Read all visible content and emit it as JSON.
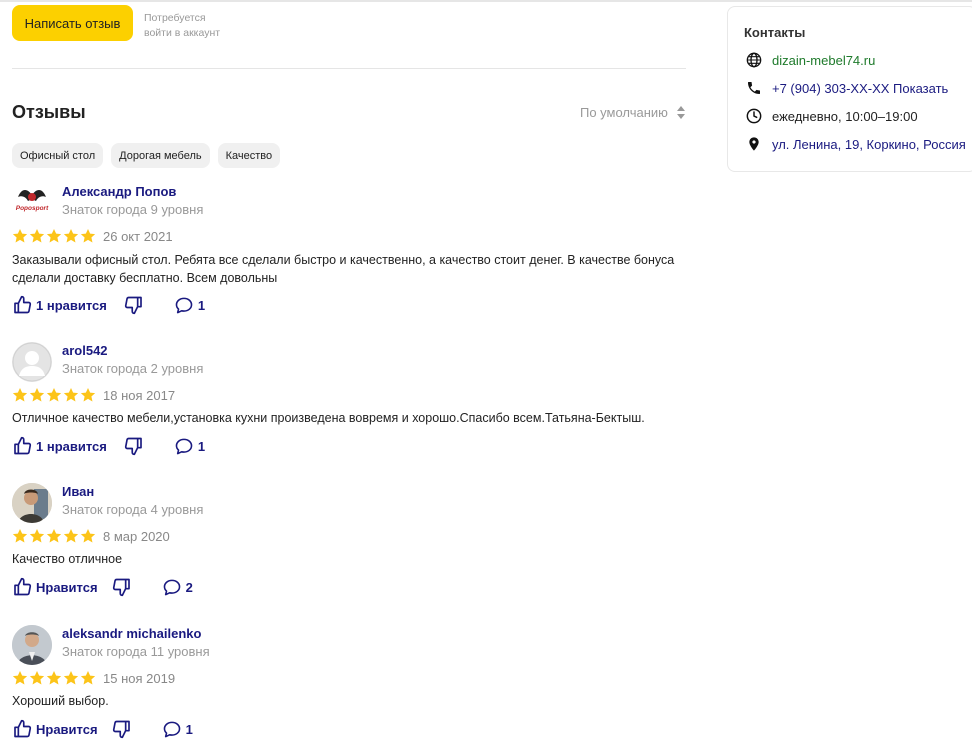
{
  "write_review": {
    "button_label": "Написать отзыв",
    "hint_line1": "Потребуется",
    "hint_line2": "войти в аккаунт"
  },
  "reviews_section": {
    "title": "Отзывы",
    "sort_label": "По умолчанию",
    "tags": [
      "Офисный стол",
      "Дорогая мебель",
      "Качество"
    ]
  },
  "reviews": [
    {
      "author": "Александр Попов",
      "level": "Знаток города 9 уровня",
      "rating": 5,
      "date": "26 окт 2021",
      "text": "Заказывали офисный стол. Ребята все сделали быстро и качественно, а качество стоит денег. В качестве бонуса сделали доставку бесплатно. Всем довольны",
      "likes_label": "1 нравится",
      "comments": "1"
    },
    {
      "author": "arol542",
      "level": "Знаток города 2 уровня",
      "rating": 5,
      "date": "18 ноя 2017",
      "text": "Отличное качество мебели,установка кухни произведена вовремя и хорошо.Спасибо всем.Татьяна-Бектыш.",
      "likes_label": "1 нравится",
      "comments": "1"
    },
    {
      "author": "Иван",
      "level": "Знаток города 4 уровня",
      "rating": 5,
      "date": "8 мар 2020",
      "text": "Качество отличное",
      "likes_label": "Нравится",
      "comments": "2"
    },
    {
      "author": "aleksandr michailenko",
      "level": "Знаток города 11 уровня",
      "rating": 5,
      "date": "15 ноя 2019",
      "text": "Хороший выбор.",
      "likes_label": "Нравится",
      "comments": "1"
    }
  ],
  "contacts": {
    "title": "Контакты",
    "website": "dizain-mebel74.ru",
    "phone": "+7 (904) 303-XX-XX Показать",
    "hours": "ежедневно, 10:00–19:00",
    "address": "ул. Ленина, 19, Коркино, Россия"
  },
  "logo_text": "Poposport",
  "colors": {
    "accent_yellow": "#fcd000",
    "link_blue": "#1a1a80",
    "site_green": "#1e7a2b",
    "star": "#fcc419",
    "muted": "#999999"
  }
}
